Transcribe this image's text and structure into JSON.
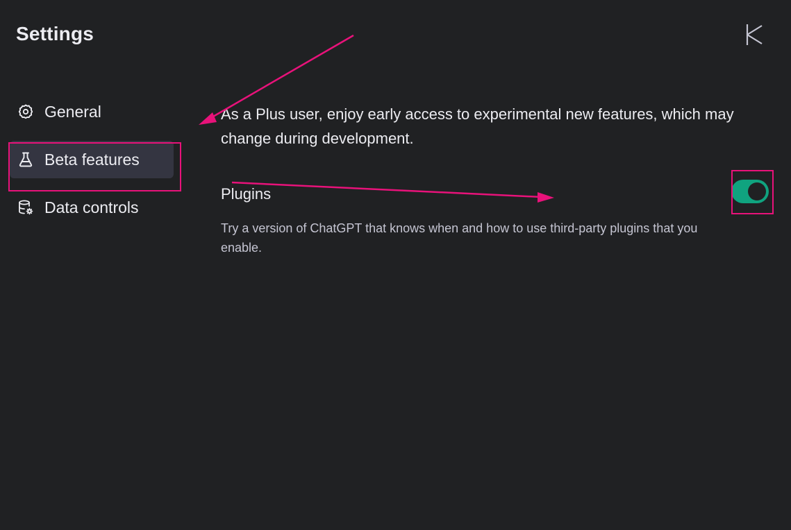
{
  "dialog": {
    "title": "Settings",
    "close_icon": "close-icon"
  },
  "sidebar": {
    "items": [
      {
        "label": "General",
        "icon": "gear-icon",
        "active": false
      },
      {
        "label": "Beta features",
        "icon": "flask-icon",
        "active": true
      },
      {
        "label": "Data controls",
        "icon": "database-settings-icon",
        "active": false
      }
    ]
  },
  "beta": {
    "intro": "As a Plus user, enjoy early access to experimental new features, which may change during development.",
    "plugins": {
      "title": "Plugins",
      "description": "Try a version of ChatGPT that knows when and how to use third-party plugins that you enable.",
      "enabled": true
    }
  },
  "colors": {
    "background": "#202123",
    "active_item": "#343541",
    "toggle_on": "#10a37f",
    "annotation": "#e8127a"
  }
}
